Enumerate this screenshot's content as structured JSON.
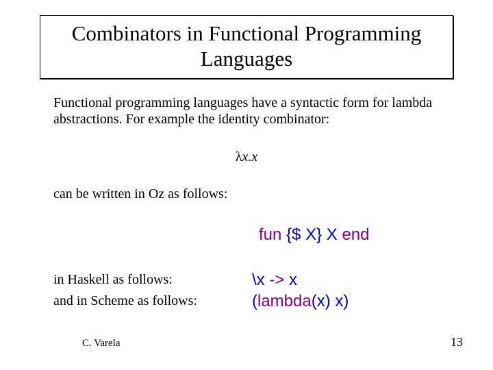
{
  "title": "Combinators in Functional Programming Languages",
  "intro": "Functional programming languages have a syntactic form for lambda abstractions.  For example the identity combinator:",
  "lambda": {
    "sym": "λ",
    "rest": "x.x"
  },
  "oz_follows": "can be written in Oz as follows:",
  "oz_code": {
    "kw_fun": "fun",
    "mid": " {$ X} X ",
    "kw_end": "end"
  },
  "haskell_label": "in Haskell as follows:",
  "scheme_label": "and in Scheme as follows:",
  "haskell_code": {
    "left": "\\x ",
    "arrow": "->",
    "right": " x"
  },
  "scheme_code": {
    "open": "(",
    "kw": "lambda",
    "rest": "(x) x)"
  },
  "footer": {
    "author": "C. Varela",
    "page": "13"
  }
}
